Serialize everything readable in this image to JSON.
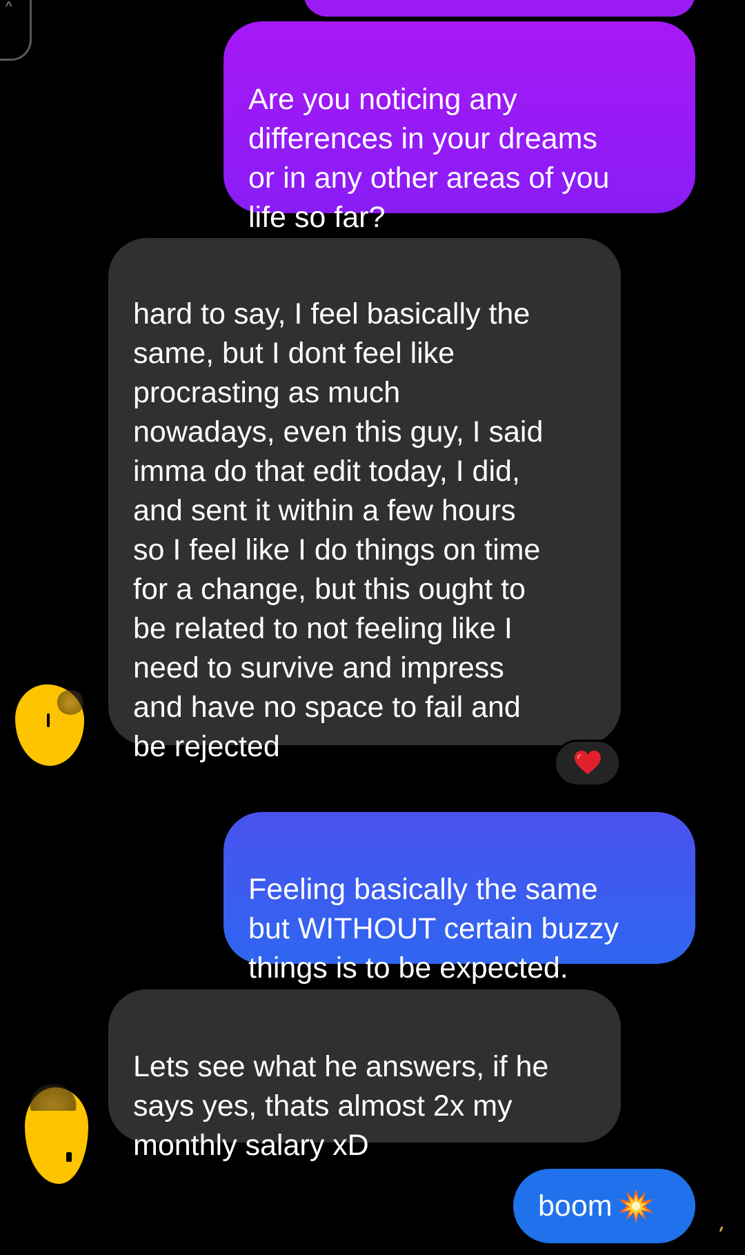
{
  "conversation": {
    "messages": [
      {
        "direction": "outgoing",
        "text": "Are you noticing any\ndifferences in your dreams\nor in any other areas of you\nlife so far?"
      },
      {
        "direction": "incoming",
        "text": "hard to say, I feel basically the\nsame, but I dont feel like\nprocrasting as much\nnowadays, even this guy, I said\nimma do that edit today, I did,\nand sent it within a few hours\nso I feel like I do things on time\nfor a change, but this ought to\nbe related to not feeling like I\nneed to survive and impress\nand have no space to fail and\nbe rejected",
        "reaction": "heart"
      },
      {
        "direction": "outgoing",
        "text": "Feeling basically the same\nbut WITHOUT certain buzzy\nthings is to be expected."
      },
      {
        "direction": "incoming",
        "text": "Lets see what he answers, if he\nsays yes, thats almost 2x my\nmonthly salary xD"
      },
      {
        "direction": "outgoing",
        "text": "boom",
        "emoji": "collision"
      }
    ]
  },
  "colors": {
    "background": "#000000",
    "outgoing_purple": "#9c1cf3",
    "outgoing_blue": "#2f66f0",
    "incoming_gray": "#303030",
    "avatar_redaction": "#ffc400",
    "reaction_heart": "#e0202b"
  },
  "icons": {
    "collapse": "chevron-up-icon",
    "reaction": "heart-icon",
    "emoji": "collision-icon"
  }
}
